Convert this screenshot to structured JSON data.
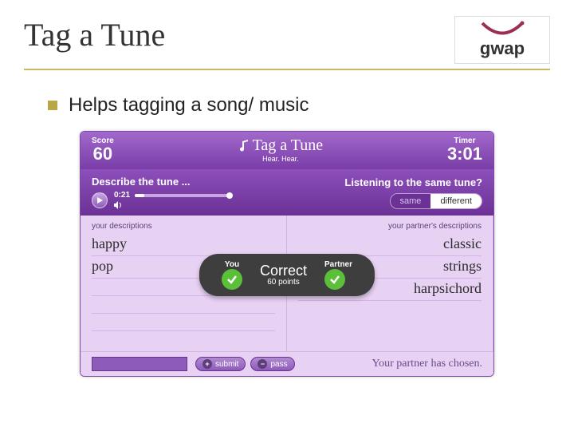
{
  "slide": {
    "title": "Tag a Tune",
    "bullet": "Helps tagging a song/ music"
  },
  "logo": {
    "text": "gwap"
  },
  "game": {
    "header": {
      "score_label": "Score",
      "score_value": "60",
      "title": "Tag a Tune",
      "subtitle": "Hear. Hear.",
      "timer_label": "Timer",
      "timer_value": "3:01"
    },
    "bar": {
      "describe": "Describe the tune ...",
      "same_question": "Listening to the same tune?",
      "same": "same",
      "different": "different",
      "time": "0:21"
    },
    "left": {
      "label": "your descriptions",
      "words": [
        "happy",
        "pop"
      ]
    },
    "right": {
      "label": "your partner's descriptions",
      "words": [
        "classic",
        "strings",
        "harpsichord"
      ]
    },
    "pill": {
      "you": "You",
      "partner": "Partner",
      "status": "Correct",
      "points": "60 points"
    },
    "footer": {
      "submit": "submit",
      "pass": "pass",
      "partner_chosen": "Your partner has chosen."
    }
  }
}
